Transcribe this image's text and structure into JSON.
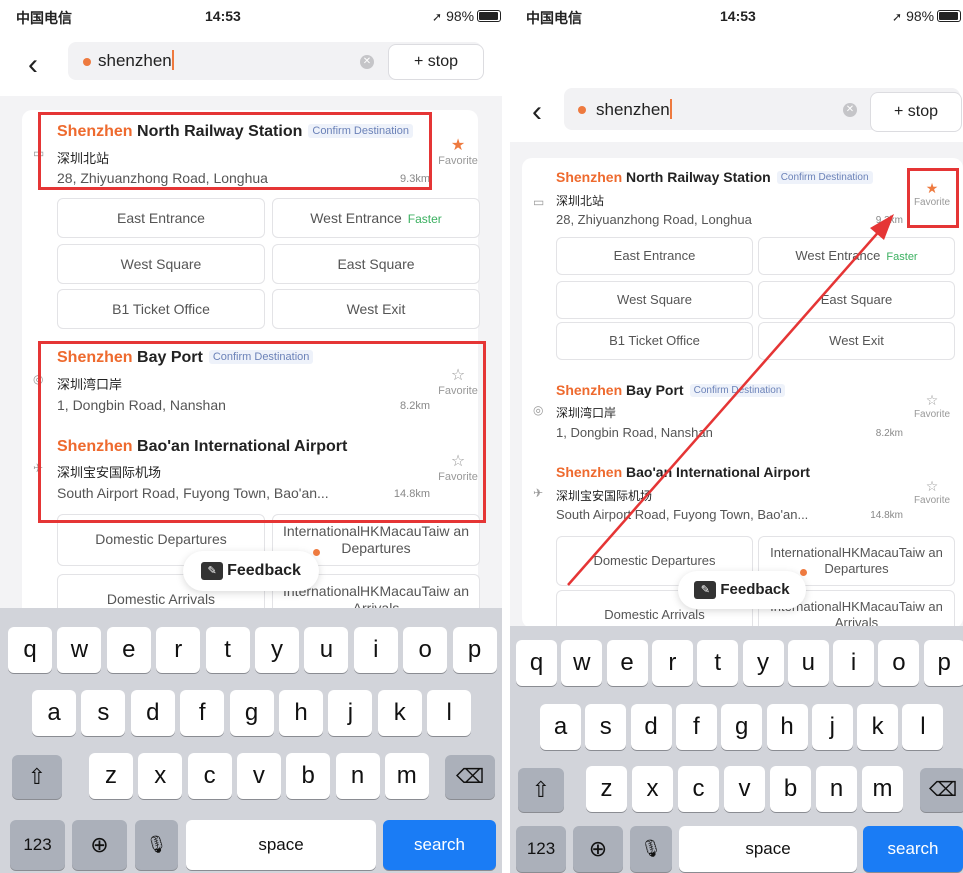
{
  "status": {
    "carrier": "中国电信",
    "time": "14:53",
    "battery": "98%"
  },
  "search": {
    "query": "shenzhen",
    "stop_label": "+ stop",
    "back_icon": "chevron-left-icon",
    "clear_icon": "clear-icon"
  },
  "results": [
    {
      "highlight": "Shenzhen",
      "rest": "North Railway Station",
      "tag": "Confirm Destination",
      "chinese": "深圳北站",
      "address": "28, Zhiyuanzhong Road, Longhua",
      "distance": "9.3km",
      "favorite_label": "Favorite",
      "favorited": true,
      "icon": "train-icon",
      "sub_entrances": [
        {
          "label": "East Entrance",
          "badge": ""
        },
        {
          "label": "West Entrance",
          "badge": "Faster"
        },
        {
          "label": "West Square",
          "badge": ""
        },
        {
          "label": "East Square",
          "badge": ""
        },
        {
          "label": "B1 Ticket Office",
          "badge": ""
        },
        {
          "label": "West Exit",
          "badge": ""
        }
      ]
    },
    {
      "highlight": "Shenzhen",
      "rest": "Bay Port",
      "tag": "Confirm Destination",
      "chinese": "深圳湾口岸",
      "address": "1, Dongbin Road, Nanshan",
      "distance": "8.2km",
      "favorite_label": "Favorite",
      "favorited": false,
      "icon": "location-pin-icon"
    },
    {
      "highlight": "Shenzhen",
      "rest": "Bao'an International Airport",
      "tag": "",
      "chinese": "深圳宝安国际机场",
      "address": "South Airport Road, Fuyong Town, Bao'an...",
      "distance": "14.8km",
      "favorite_label": "Favorite",
      "favorited": false,
      "icon": "airplane-icon",
      "sub_entrances": [
        {
          "label": "Domestic Departures"
        },
        {
          "label": "InternationalHKMacauTaiw an Departures"
        },
        {
          "label": "Domestic Arrivals"
        },
        {
          "label": "InternationalHKMacauTaiw an Arrivals"
        }
      ]
    }
  ],
  "feedback": {
    "label": "Feedback"
  },
  "keyboard": {
    "row1": [
      "q",
      "w",
      "e",
      "r",
      "t",
      "y",
      "u",
      "i",
      "o",
      "p"
    ],
    "row2": [
      "a",
      "s",
      "d",
      "f",
      "g",
      "h",
      "j",
      "k",
      "l"
    ],
    "row3": [
      "z",
      "x",
      "c",
      "v",
      "b",
      "n",
      "m"
    ],
    "shift_icon": "shift-icon",
    "backspace_icon": "backspace-icon",
    "numbers_label": "123",
    "globe_icon": "globe-icon",
    "mic_icon": "microphone-icon",
    "space_label": "space",
    "search_label": "search"
  },
  "colors": {
    "accent": "#ee7a3f",
    "highlight_box": "#e53535",
    "search_key": "#1a7cf5",
    "faster": "#3bb060"
  }
}
